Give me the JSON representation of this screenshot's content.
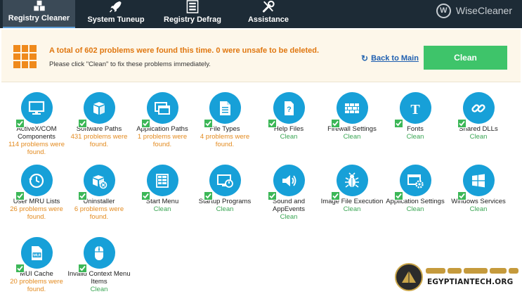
{
  "nav": {
    "tabs": [
      {
        "label": "Registry Cleaner",
        "icon": "registry-cubes-icon",
        "active": true
      },
      {
        "label": "System Tuneup",
        "icon": "rocket-icon",
        "active": false
      },
      {
        "label": "Registry Defrag",
        "icon": "defrag-bars-icon",
        "active": false
      },
      {
        "label": "Assistance",
        "icon": "tools-icon",
        "active": false
      }
    ],
    "brand": {
      "logo_letter": "W",
      "name": "WiseCleaner"
    }
  },
  "banner": {
    "summary": "A total of 602 problems were found this time. 0 were unsafe to be deleted.",
    "hint": "Please click \"Clean\" to fix these problems immediately.",
    "back_label": "Back to Main",
    "clean_label": "Clean",
    "colors": {
      "accent": "#ef8a1c",
      "clean_button": "#3ec46a",
      "link": "#1f5fb0"
    }
  },
  "colors": {
    "icon_circle": "#17a0d8",
    "check": "#3cb757",
    "found": "#e38a1e",
    "clean": "#3aa654"
  },
  "items": [
    {
      "name": "ActiveX/COM Components",
      "status": "114 problems were found.",
      "found": true,
      "checked": true,
      "icon": "monitor-icon"
    },
    {
      "name": "Software Paths",
      "status": "431 problems were found.",
      "found": true,
      "checked": true,
      "icon": "software-box-icon"
    },
    {
      "name": "Application Paths",
      "status": "1 problems were found.",
      "found": true,
      "checked": true,
      "icon": "app-windows-icon"
    },
    {
      "name": "File Types",
      "status": "4 problems were found.",
      "found": true,
      "checked": true,
      "icon": "document-icon"
    },
    {
      "name": "Help Files",
      "status": "Clean",
      "found": false,
      "checked": true,
      "icon": "help-file-icon"
    },
    {
      "name": "Firewall Settings",
      "status": "Clean",
      "found": false,
      "checked": true,
      "icon": "firewall-icon"
    },
    {
      "name": "Fonts",
      "status": "Clean",
      "found": false,
      "checked": true,
      "icon": "font-icon"
    },
    {
      "name": "Shared DLLs",
      "status": "Clean",
      "found": false,
      "checked": true,
      "icon": "chain-link-icon"
    },
    {
      "name": "User MRU Lists",
      "status": "26 problems were found.",
      "found": true,
      "checked": true,
      "icon": "history-clock-icon"
    },
    {
      "name": "Uninstaller",
      "status": "6 problems were found.",
      "found": true,
      "checked": true,
      "icon": "uninstall-box-icon"
    },
    {
      "name": "Start Menu",
      "status": "Clean",
      "found": false,
      "checked": true,
      "icon": "start-menu-icon"
    },
    {
      "name": "Startup Programs",
      "status": "Clean",
      "found": false,
      "checked": true,
      "icon": "startup-power-icon"
    },
    {
      "name": "Sound and AppEvents",
      "status": "Clean",
      "found": false,
      "checked": true,
      "icon": "speaker-icon"
    },
    {
      "name": "Image File Execution",
      "status": "Clean",
      "found": false,
      "checked": true,
      "icon": "bug-icon"
    },
    {
      "name": "Application Settings",
      "status": "Clean",
      "found": false,
      "checked": true,
      "icon": "app-settings-icon"
    },
    {
      "name": "Windows Services",
      "status": "Clean",
      "found": false,
      "checked": true,
      "icon": "windows-logo-icon"
    },
    {
      "name": "MUI Cache",
      "status": "20 problems were found.",
      "found": true,
      "checked": true,
      "icon": "mui-file-icon",
      "badge": "MUI"
    },
    {
      "name": "Invalid Context Menu Items",
      "status": "Clean",
      "found": false,
      "checked": true,
      "icon": "mouse-icon"
    }
  ],
  "watermark": {
    "text": "EGYPTIANTECH.ORG"
  }
}
